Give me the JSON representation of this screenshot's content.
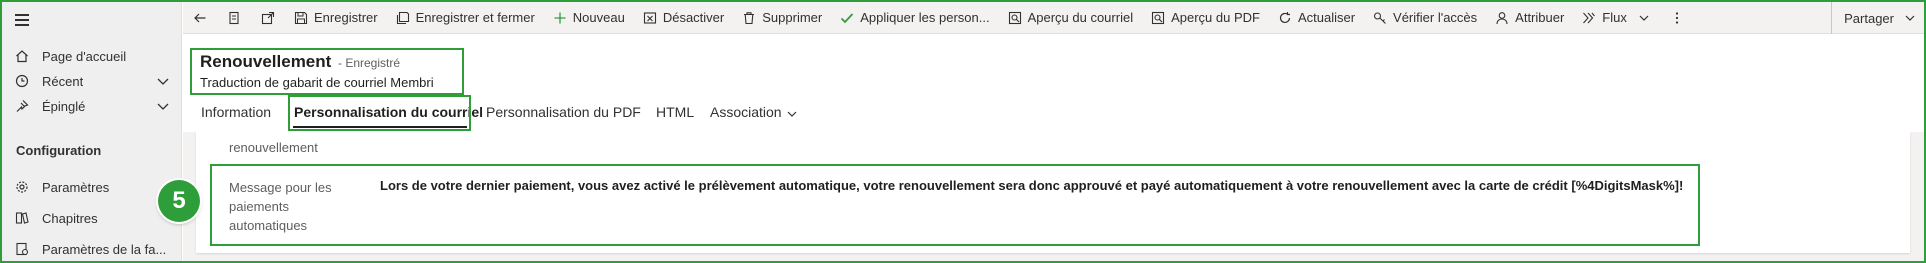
{
  "sidebar": {
    "items": [
      {
        "label": "Page d'accueil",
        "icon": "home-icon"
      },
      {
        "label": "Récent",
        "icon": "clock-icon"
      },
      {
        "label": "Épinglé",
        "icon": "pin-icon"
      },
      {
        "label": "Paramètres",
        "icon": "gear-icon"
      },
      {
        "label": "Chapitres",
        "icon": "chapters-icon"
      },
      {
        "label": "Paramètres de la fa...",
        "icon": "settings-doc-icon"
      }
    ],
    "section_title": "Configuration"
  },
  "commandbar": {
    "items": [
      {
        "label": "Enregistrer",
        "icon": "save-icon"
      },
      {
        "label": "Enregistrer et fermer",
        "icon": "save-close-icon"
      },
      {
        "label": "Nouveau",
        "icon": "plus-icon"
      },
      {
        "label": "Désactiver",
        "icon": "deactivate-icon"
      },
      {
        "label": "Supprimer",
        "icon": "trash-icon"
      },
      {
        "label": "Appliquer les person...",
        "icon": "check-icon"
      },
      {
        "label": "Aperçu du courriel",
        "icon": "preview-icon"
      },
      {
        "label": "Aperçu du PDF",
        "icon": "pdf-preview-icon"
      },
      {
        "label": "Actualiser",
        "icon": "refresh-icon"
      },
      {
        "label": "Vérifier l'accès",
        "icon": "key-icon"
      },
      {
        "label": "Attribuer",
        "icon": "person-icon"
      },
      {
        "label": "Flux",
        "icon": "flow-icon"
      }
    ],
    "share_label": "Partager"
  },
  "record": {
    "name": "Renouvellement",
    "status": "- Enregistré",
    "entity": "Traduction de gabarit de courriel Membri"
  },
  "tabs": [
    {
      "label": "Information"
    },
    {
      "label": "Personnalisation du courriel"
    },
    {
      "label": "Personnalisation du PDF"
    },
    {
      "label": "HTML"
    },
    {
      "label": "Association"
    }
  ],
  "fields": {
    "prev_label_tail": "renouvellement",
    "auto_payment": {
      "label": "Message pour les paiements automatiques",
      "value": "Lors de votre dernier paiement, vous avez activé le prélèvement automatique, votre renouvellement sera donc approuvé et payé automatiquement à votre renouvellement avec la carte de crédit [%4DigitsMask%]!"
    }
  },
  "annotation": {
    "step": "5"
  },
  "colors": {
    "annotation_green": "#2e9e3a",
    "accent": "#0078d4"
  }
}
